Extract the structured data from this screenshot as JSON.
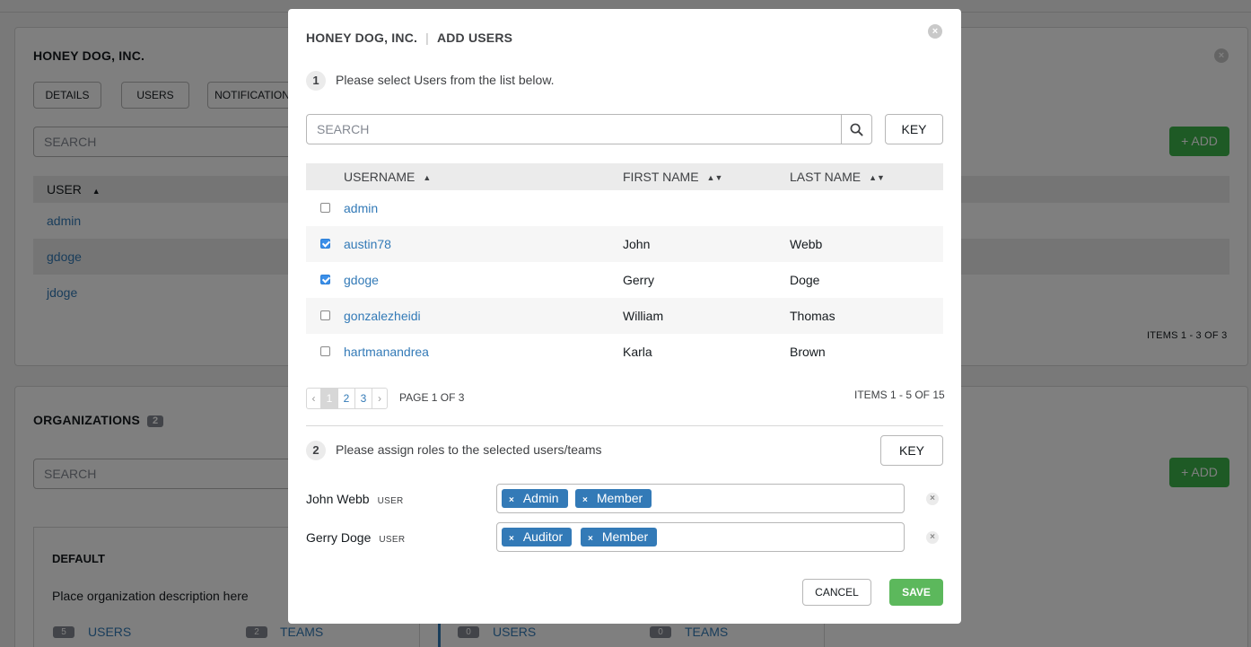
{
  "background": {
    "org_panel": {
      "title": "HONEY DOG, INC.",
      "tabs": [
        "DETAILS",
        "USERS",
        "NOTIFICATION"
      ],
      "search_placeholder": "SEARCH",
      "add_label": "+ ADD",
      "table_header": "USER",
      "rows": [
        "admin",
        "gdoge",
        "jdoge"
      ],
      "items": "ITEMS  1 - 3 OF 3"
    },
    "orgs_panel": {
      "title": "ORGANIZATIONS",
      "count": "2",
      "search_placeholder": "SEARCH",
      "add_label": "+ ADD",
      "card": {
        "title": "DEFAULT",
        "description": "Place organization description here",
        "users_count": "5",
        "users_label": "USERS",
        "teams_count": "2",
        "teams_label": "TEAMS"
      },
      "card2": {
        "users_count": "0",
        "users_label": "USERS",
        "teams_count": "0",
        "teams_label": "TEAMS"
      }
    }
  },
  "modal": {
    "org_name": "HONEY DOG, INC.",
    "separator": "|",
    "title": "ADD USERS",
    "step1": {
      "num": "1",
      "text": "Please select Users from the list below."
    },
    "search_placeholder": "SEARCH",
    "key_label": "KEY",
    "columns": {
      "username": "USERNAME",
      "first_name": "FIRST NAME",
      "last_name": "LAST NAME"
    },
    "rows": [
      {
        "username": "admin",
        "first": "",
        "last": "",
        "checked": false
      },
      {
        "username": "austin78",
        "first": "John",
        "last": "Webb",
        "checked": true
      },
      {
        "username": "gdoge",
        "first": "Gerry",
        "last": "Doge",
        "checked": true
      },
      {
        "username": "gonzalezheidi",
        "first": "William",
        "last": "Thomas",
        "checked": false
      },
      {
        "username": "hartmanandrea",
        "first": "Karla",
        "last": "Brown",
        "checked": false
      }
    ],
    "pagination": {
      "prev": "‹",
      "pages": [
        "1",
        "2",
        "3"
      ],
      "next": "›",
      "label": "PAGE 1 OF 3"
    },
    "items": "ITEMS  1 - 5 OF 15",
    "step2": {
      "num": "2",
      "text": "Please assign roles to the selected users/teams"
    },
    "key2_label": "KEY",
    "assignments": [
      {
        "name": "John Webb",
        "type": "USER",
        "roles": [
          "Admin",
          "Member"
        ]
      },
      {
        "name": "Gerry Doge",
        "type": "USER",
        "roles": [
          "Auditor",
          "Member"
        ]
      }
    ],
    "cancel_label": "CANCEL",
    "save_label": "SAVE",
    "colors": {
      "link": "#337ab7",
      "tag": "#337ab7",
      "save": "#5cb85c",
      "add": "#3cb44a",
      "checkbox": "#3b8fe8"
    }
  }
}
